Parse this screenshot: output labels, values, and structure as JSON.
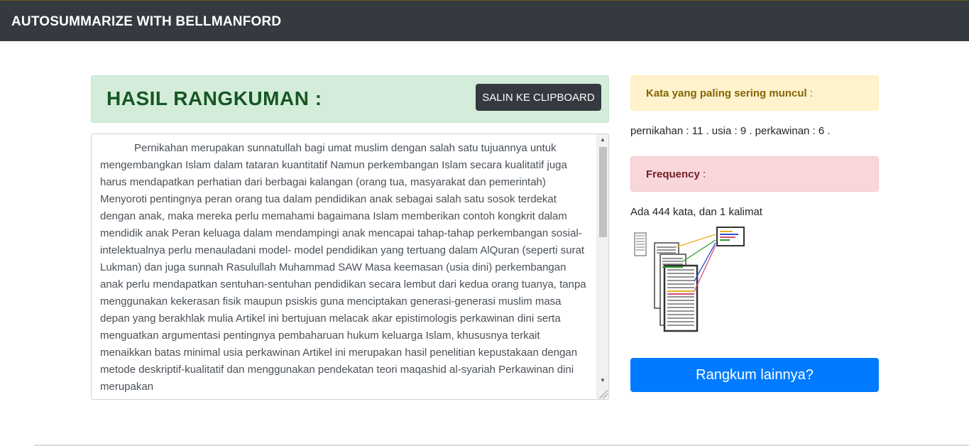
{
  "navbar": {
    "brand": "AUTOSUMMARIZE WITH BELLMANFORD"
  },
  "result": {
    "title": "HASIL RANGKUMAN :",
    "copy_button": "SALIN KE CLIPBOARD",
    "summary": "Pernikahan merupakan sunnatullah bagi umat muslim dengan salah satu tujuannya untuk mengembangkan Islam dalam tataran kuantitatif  Namun perkembangan Islam secara kualitatif juga harus mendapatkan perhatian dari berbagai kalangan (orang tua, masyarakat dan pemerintah)  Menyoroti pentingnya peran orang tua dalam pendidikan anak sebagai salah satu sosok terdekat dengan anak, maka mereka perlu memahami bagaimana Islam memberikan contoh kongkrit dalam mendidik anak  Peran keluaga dalam mendampingi anak mencapai tahap-tahap perkembangan sosial-intelektualnya perlu menauladani model- model pendidikan yang tertuang dalam AlQuran (seperti surat Lukman) dan juga sunnah Rasulullah Muhammad SAW  Masa keemasan (usia dini) perkembangan anak perlu mendapatkan sentuhan-sentuhan pendidikan secara lembut dari kedua orang tuanya, tanpa menggunakan kekerasan fisik maupun psiskis guna menciptakan generasi-generasi muslim masa depan yang berakhlak mulia Artikel ini bertujuan melacak akar epistimologis perkawinan dini serta menguatkan argumentasi pentingnya pembaharuan hukum keluarga Islam, khususnya terkait menaikkan batas minimal usia perkawinan  Artikel ini merupakan hasil penelitian kepustakaan dengan metode deskriptif-kualitatif dan menggunakan pendekatan teori maqashid al-syariah  Perkawinan dini merupakan"
  },
  "sidebar": {
    "frequent_label": "Kata yang paling sering muncul",
    "frequent_suffix": " :",
    "frequent_words": "pernikahan : 11 . usia : 9 . perkawinan : 6 .",
    "frequency_label": "Frequency",
    "frequency_suffix": " :",
    "frequency_text": "Ada 444 kata, dan 1 kalimat",
    "again_button": "Rangkum lainnya?"
  },
  "colors": {
    "navbar": "#343a40",
    "success_bg": "#d4edda",
    "warning_bg": "#fff3cd",
    "danger_bg": "#f8d7da",
    "primary": "#007bff"
  },
  "icons": {
    "illustration": "document-summary-illustration"
  }
}
